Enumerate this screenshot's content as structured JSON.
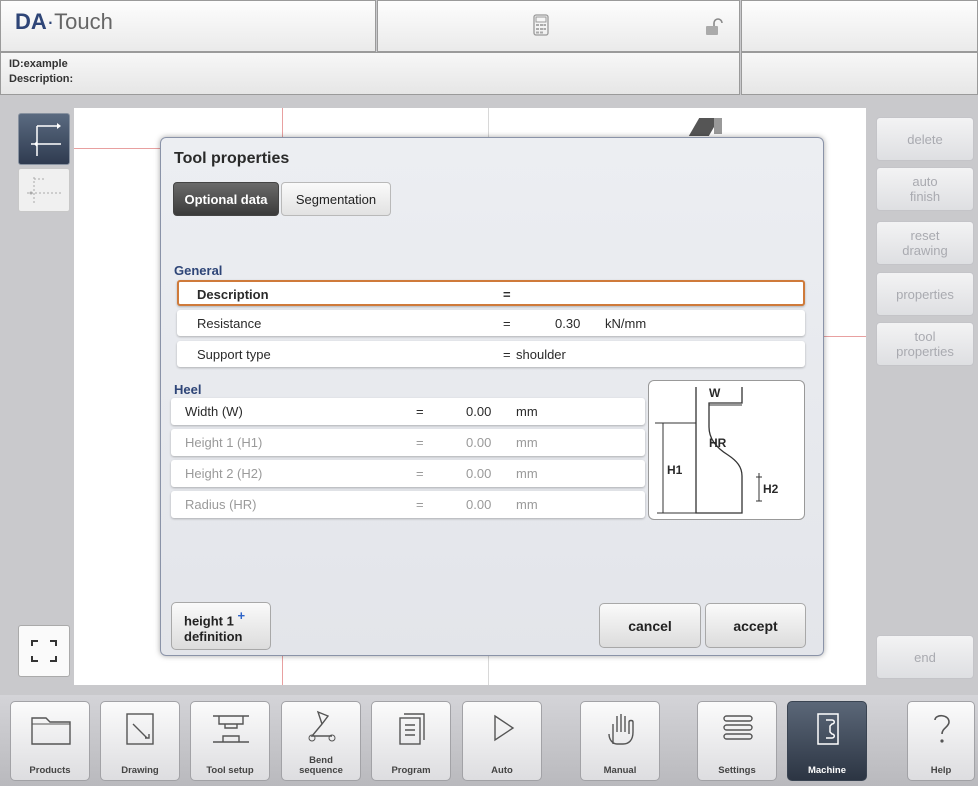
{
  "header": {
    "logo_brand": "DA",
    "logo_sep": "·",
    "logo_product": "Touch",
    "calc_icon": "calculator-icon",
    "lock_icon": "unlock-icon",
    "id_line": "ID:example",
    "description_line": "Description:"
  },
  "side_right": {
    "delete": "delete",
    "auto_finish": "auto finish",
    "reset_drawing": "reset drawing",
    "properties": "properties",
    "tool_properties": "tool properties",
    "end": "end"
  },
  "dialog": {
    "title": "Tool properties",
    "tabs": [
      "Optional data",
      "Segmentation"
    ],
    "general_header": "General",
    "general_rows": [
      {
        "label": "Description",
        "eq": "=",
        "value": "",
        "unit": ""
      },
      {
        "label": "Resistance",
        "eq": "=",
        "value": "0.30",
        "unit": "kN/mm"
      },
      {
        "label": "Support type",
        "eq": "=",
        "value": "shoulder",
        "unit": ""
      }
    ],
    "heel_header": "Heel",
    "heel_rows": [
      {
        "label": "Width (W)",
        "eq": "=",
        "value": "0.00",
        "unit": "mm"
      },
      {
        "label": "Height 1 (H1)",
        "eq": "=",
        "value": "0.00",
        "unit": "mm"
      },
      {
        "label": "Height 2 (H2)",
        "eq": "=",
        "value": "0.00",
        "unit": "mm"
      },
      {
        "label": "Radius (HR)",
        "eq": "=",
        "value": "0.00",
        "unit": "mm"
      }
    ],
    "diagram_labels": {
      "w": "W",
      "hr": "HR",
      "h1": "H1",
      "h2": "H2"
    },
    "height_def_line1": "height 1",
    "height_def_plus": "+",
    "height_def_line2": "definition",
    "cancel": "cancel",
    "accept": "accept"
  },
  "nav": [
    {
      "label": "Products",
      "icon": "folder-icon"
    },
    {
      "label": "Drawing",
      "icon": "drawing-icon"
    },
    {
      "label": "Tool setup",
      "icon": "tool-setup-icon"
    },
    {
      "label": "Bend sequence",
      "icon": "bend-sequence-icon"
    },
    {
      "label": "Program",
      "icon": "program-icon"
    },
    {
      "label": "Auto",
      "icon": "play-icon"
    },
    {
      "label": "Manual",
      "icon": "hand-icon"
    },
    {
      "label": "Settings",
      "icon": "settings-icon"
    },
    {
      "label": "Machine",
      "icon": "machine-icon"
    },
    {
      "label": "Help",
      "icon": "help-icon"
    }
  ],
  "colors": {
    "accent_blue": "#2e4577",
    "selection_orange": "#cf7a3a",
    "active_nav": "#3a4452"
  }
}
